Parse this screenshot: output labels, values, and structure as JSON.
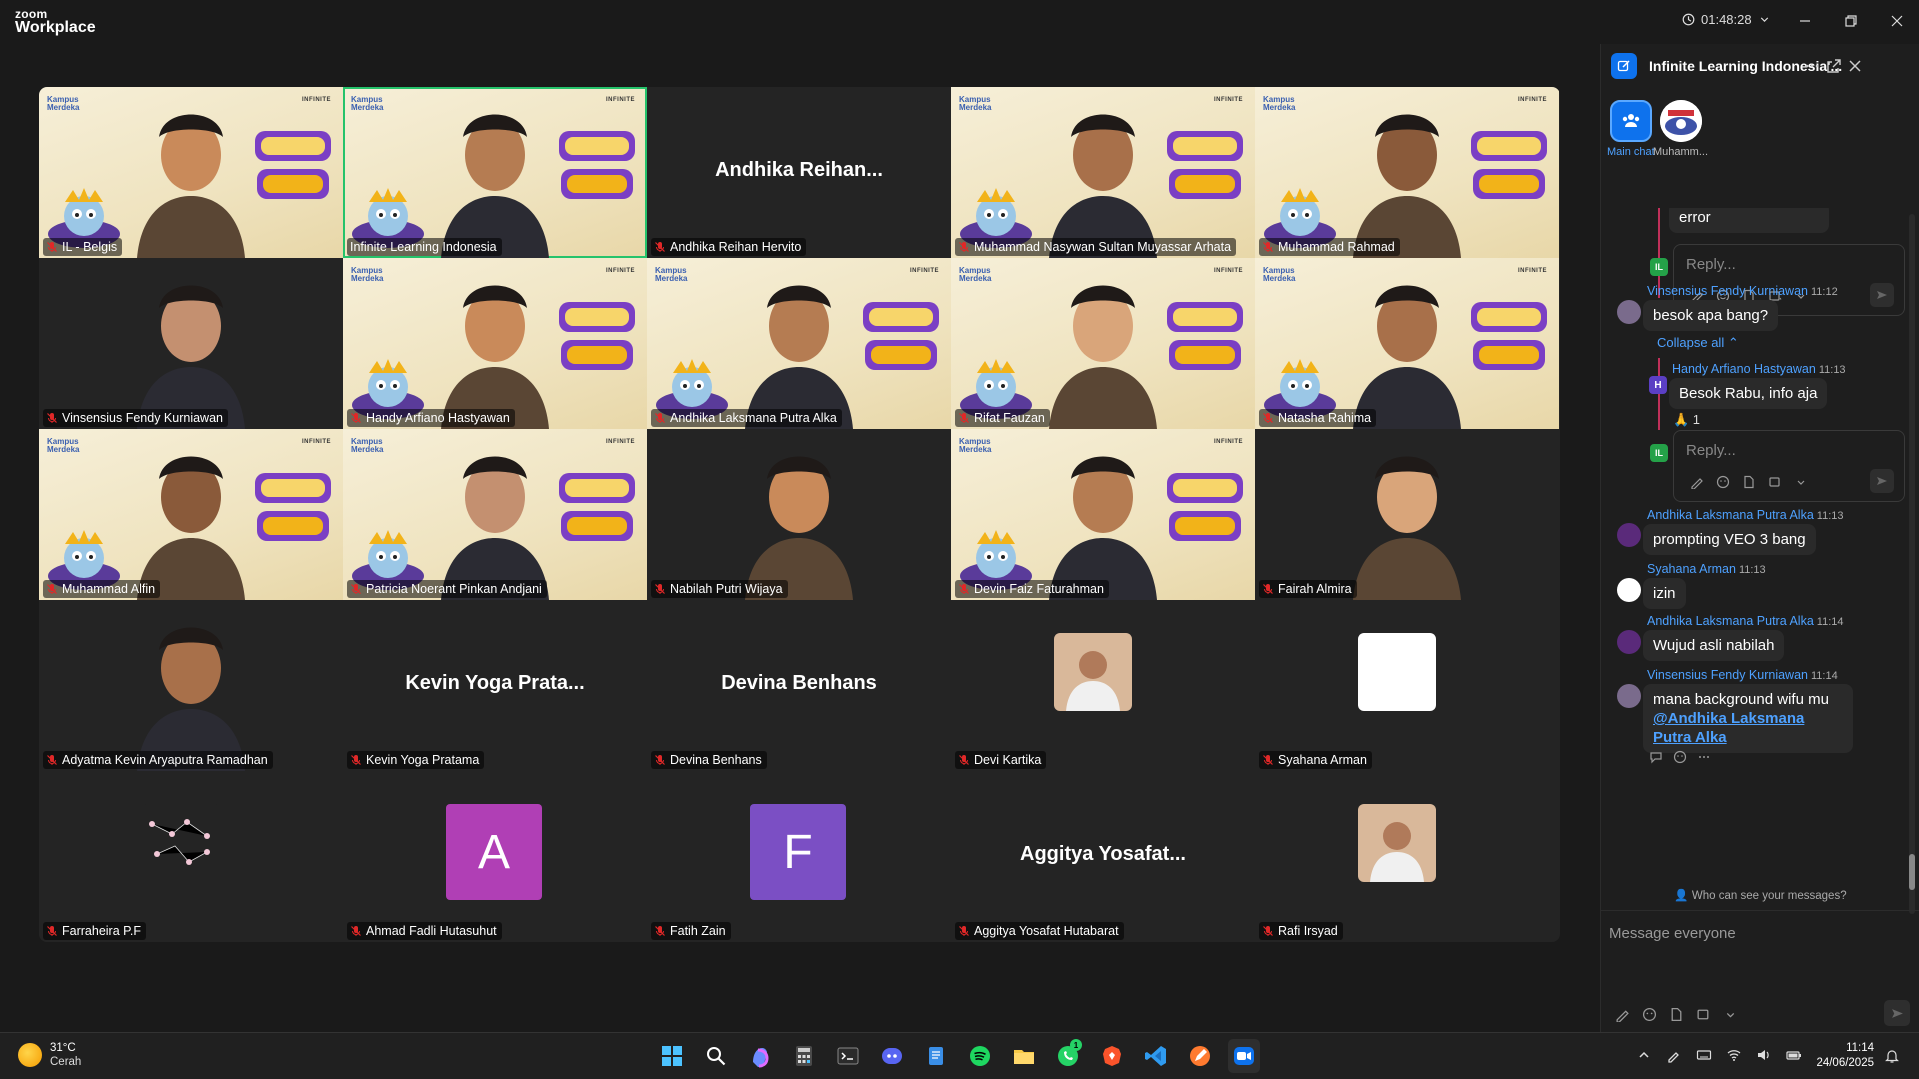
{
  "window": {
    "logo_top": "zoom",
    "logo_bottom": "Workplace",
    "timer": "01:48:28"
  },
  "tile_branding": {
    "kampus": "Kampus Merdeka",
    "infinite": "INFINITE"
  },
  "participants": [
    {
      "name": "IL - Belgis",
      "video": true
    },
    {
      "name": "Infinite Learning Indonesia",
      "video": true,
      "active_speaker": true
    },
    {
      "name": "Andhika Reihan Hervito",
      "video": false,
      "display": "Andhika  Reihan..."
    },
    {
      "name": "Muhammad Nasywan Sultan Muyassar Arhata",
      "video": true
    },
    {
      "name": "Muhammad Rahmad",
      "video": true
    },
    {
      "name": "Vinsensius Fendy Kurniawan",
      "video": true
    },
    {
      "name": "Handy Arfiano Hastyawan",
      "video": true
    },
    {
      "name": "Andhika Laksmana Putra Alka",
      "video": true
    },
    {
      "name": "Rifat Fauzan",
      "video": true
    },
    {
      "name": "Natasha Rahima",
      "video": true
    },
    {
      "name": "Muhammad Alfin",
      "video": true
    },
    {
      "name": "Patricia Noerant Pinkan Andjani",
      "video": true
    },
    {
      "name": "Nabilah Putri Wijaya",
      "video": true
    },
    {
      "name": "Devin Faiz Faturahman",
      "video": true
    },
    {
      "name": "Fairah Almira",
      "video": true
    },
    {
      "name": "Adyatma Kevin Aryaputra Ramadhan",
      "video": true
    },
    {
      "name": "Kevin Yoga Pratama",
      "video": false,
      "display": "Kevin Yoga Prata..."
    },
    {
      "name": "Devina Benhans",
      "video": false,
      "display": "Devina Benhans"
    },
    {
      "name": "Devi Kartika",
      "video": false,
      "photo": true
    },
    {
      "name": "Syahana Arman",
      "video": false,
      "photo": true
    },
    {
      "name": "Farraheira P.F",
      "video": false,
      "photo": true
    },
    {
      "name": "Ahmad Fadli Hutasuhut",
      "video": false,
      "letter": "A",
      "letter_color": "#b03fb5"
    },
    {
      "name": "Fatih Zain",
      "video": false,
      "letter": "F",
      "letter_color": "#7b4fc4"
    },
    {
      "name": "Aggitya Yosafat Hutabarat",
      "video": false,
      "display": "Aggitya  Yosafat..."
    },
    {
      "name": "Rafi Irsyad",
      "video": false,
      "photo": true
    }
  ],
  "chat": {
    "title": "Infinite Learning Indonesia'...",
    "tabs": [
      {
        "label": "Main chat"
      },
      {
        "label": "Muhamm..."
      }
    ],
    "top_fragment": "error",
    "reply_placeholder": "Reply...",
    "il_badge": "IL",
    "messages": [
      {
        "sender": "Vinsensius Fendy Kurniawan",
        "time": "11:12",
        "text": "besok apa bang?"
      },
      {
        "sender": "Handy Arfiano Hastyawan",
        "time": "11:13",
        "text": "Besok Rabu, info aja",
        "reaction": "🙏 1",
        "avatar_letter": "H"
      },
      {
        "sender": "Andhika Laksmana Putra Alka",
        "time": "11:13",
        "text": "prompting VEO 3 bang"
      },
      {
        "sender": "Syahana Arman",
        "time": "11:13",
        "text": "izin"
      },
      {
        "sender": "Andhika Laksmana Putra Alka",
        "time": "11:14",
        "text": "Wujud asli nabilah"
      },
      {
        "sender": "Vinsensius Fendy Kurniawan",
        "time": "11:14",
        "text": "mana background wifu mu",
        "mention": "@Andhika Laksmana Putra Alka"
      }
    ],
    "collapse_label": "Collapse all",
    "privacy_note": "Who can see your messages?",
    "compose_placeholder": "Message everyone"
  },
  "taskbar": {
    "temperature": "31°C",
    "condition": "Cerah",
    "time": "11:14",
    "date": "24/06/2025",
    "whatsapp_badge": "1",
    "apps": [
      "start-icon",
      "search-icon",
      "copilot-icon",
      "calculator-icon",
      "terminal-icon",
      "discord-icon",
      "notepad-icon",
      "spotify-icon",
      "file-explorer-icon",
      "whatsapp-icon",
      "brave-icon",
      "vscode-icon",
      "drawing-app-icon",
      "zoom-icon"
    ]
  },
  "colors": {
    "accent": "#0e72ed",
    "active_speaker": "#25c36b",
    "mic_muted": "#e02828",
    "link": "#4ea1ff"
  }
}
